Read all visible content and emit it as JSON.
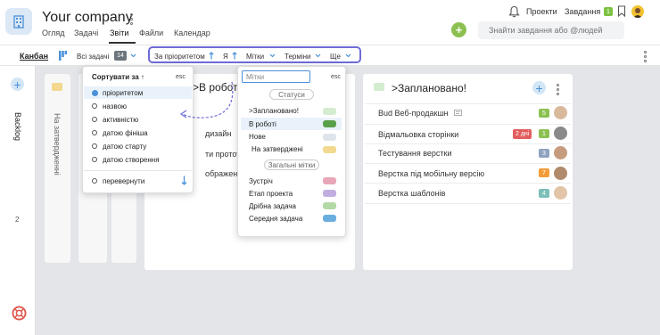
{
  "header": {
    "company": "Your company",
    "tabs": [
      "Огляд",
      "Задачі",
      "Звіти",
      "Файли",
      "Календар"
    ],
    "active_tab": "Звіти",
    "links": [
      "Проекти",
      "Завдання"
    ],
    "tasks_badge": "1",
    "search_placeholder": "Знайти завдання або @людей"
  },
  "toolbar": {
    "view": "Канбан",
    "all_tasks": "Всі задачі",
    "all_tasks_count": "14",
    "filters": [
      "За пріоритетом",
      "Я",
      "Мітки",
      "Терміни",
      "Ще"
    ]
  },
  "sort_menu": {
    "title": "Сортувати за ↑",
    "esc": "esc",
    "options": [
      "пріоритетом",
      "назвою",
      "активністю",
      "датою фініша",
      "датою старту",
      "датою створення"
    ],
    "selected": "пріоритетом",
    "reverse": "перевернути",
    "reverse_icon": "arrow-down-icon"
  },
  "labels_menu": {
    "placeholder": "Мітки",
    "esc": "esc",
    "statuses_header": "Статуси",
    "statuses": [
      {
        "name": ">Заплановано!",
        "color": "#d4ecd0"
      },
      {
        "name": "В роботі",
        "color": "#5aa04a"
      },
      {
        "name": "Нове",
        "color": "#dfe3ea"
      },
      {
        "name": "На затверджені",
        "color": "#f2d98f"
      }
    ],
    "general_header": "Загальні мітки",
    "general": [
      {
        "name": "Зустріч",
        "color": "#e9a6b8"
      },
      {
        "name": "Етап проекта",
        "color": "#c0aee0"
      },
      {
        "name": "Дрібна задача",
        "color": "#b3d9a6"
      },
      {
        "name": "Середня задача",
        "color": "#6aaee0"
      }
    ]
  },
  "board": {
    "backlog_label": "Backlog",
    "backlog_count": "2",
    "collapsed_column": "На затвердженні",
    "in_progress_title": ">В роботі",
    "in_progress_tasks": [
      "дизайн",
      "ти прототип",
      "ображення"
    ],
    "planned": {
      "title": ">Заплановано!",
      "tasks": [
        {
          "name": "Bud Веб-продакшн",
          "count": "5",
          "color": "#8cc152"
        },
        {
          "name": "Відмальовка сторінки",
          "days": "2 дні",
          "count": "1",
          "color": "#8cc152"
        },
        {
          "name": "Тестування верстки",
          "count": "3",
          "color": "#8fa2c0"
        },
        {
          "name": "Верстка під мобільну версію",
          "count": "7",
          "color": "#f39c3a"
        },
        {
          "name": "Верстка шаблонів",
          "count": "4",
          "color": "#7bbfb8"
        }
      ]
    }
  },
  "colors": {
    "accent": "#6e6bd6",
    "link": "#4a90d9",
    "green": "#8cc152"
  }
}
